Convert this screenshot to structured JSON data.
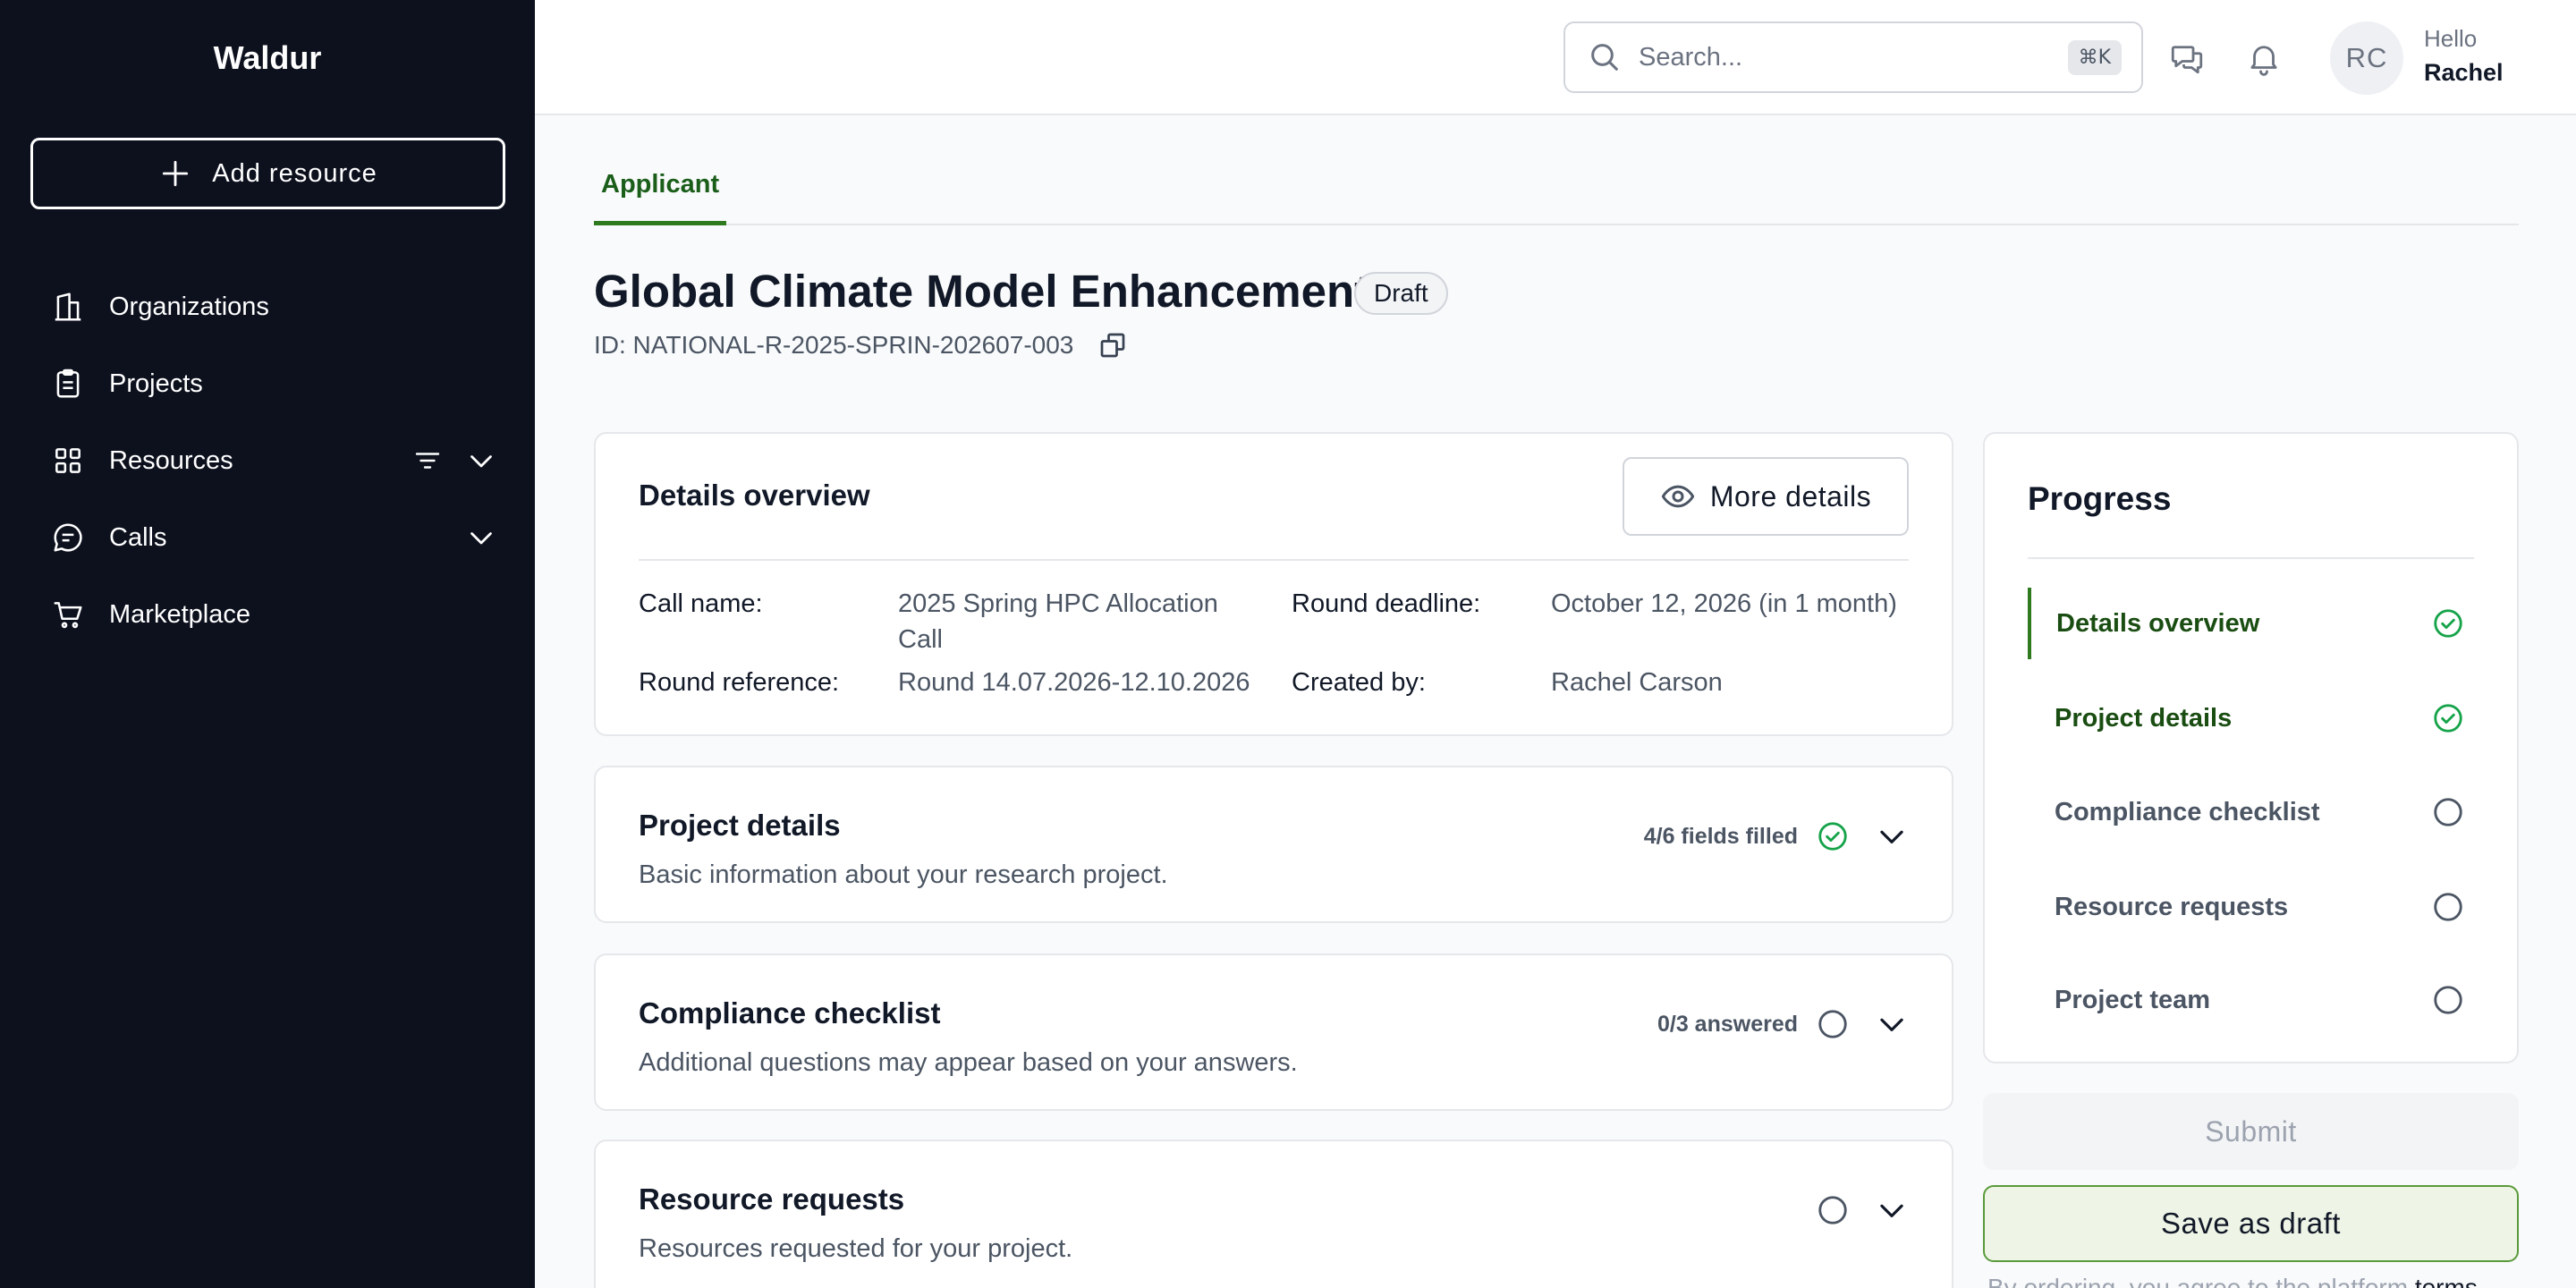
{
  "sidebar": {
    "brand": "Waldur",
    "add_resource_label": "Add resource",
    "items": [
      {
        "label": "Organizations",
        "icon": "building-icon"
      },
      {
        "label": "Projects",
        "icon": "clipboard-icon"
      },
      {
        "label": "Resources",
        "icon": "grid-icon"
      },
      {
        "label": "Calls",
        "icon": "chat-bubble-icon"
      },
      {
        "label": "Marketplace",
        "icon": "cart-icon"
      }
    ]
  },
  "header": {
    "search_placeholder": "Search...",
    "search_shortcut": "⌘K",
    "avatar_initials": "RC",
    "greeting": "Hello",
    "user_name": "Rachel"
  },
  "tabs": [
    {
      "label": "Applicant",
      "active": true
    }
  ],
  "proposal": {
    "title": "Global Climate Model Enhancement",
    "status": "Draft",
    "id_text": "ID: NATIONAL-R-2025-SPRIN-202607-003"
  },
  "details": {
    "title": "Details overview",
    "more_details_label": "More details",
    "call_name_label": "Call name:",
    "call_name_line1": "2025 Spring HPC Allocation",
    "call_name_line2": "Call",
    "round_deadline_label": "Round deadline:",
    "round_deadline": "October 12, 2026 (in 1 month)",
    "round_reference_label": "Round reference:",
    "round_reference": "Round 14.07.2026-12.10.2026",
    "created_by_label": "Created by:",
    "created_by": "Rachel Carson"
  },
  "sections": [
    {
      "title": "Project details",
      "subtitle": "Basic information about your research project.",
      "status": "4/6 fields filled",
      "complete": true
    },
    {
      "title": "Compliance checklist",
      "subtitle": "Additional questions may appear based on your answers.",
      "status": "0/3 answered",
      "complete": false
    },
    {
      "title": "Resource requests",
      "subtitle": "Resources requested for your project.",
      "status": "",
      "complete": false
    }
  ],
  "progress": {
    "title": "Progress",
    "steps": [
      {
        "label": "Details overview",
        "done": true
      },
      {
        "label": "Project details",
        "done": true
      },
      {
        "label": "Compliance checklist",
        "done": false
      },
      {
        "label": "Resource requests",
        "done": false
      },
      {
        "label": "Project team",
        "done": false
      }
    ]
  },
  "actions": {
    "submit_label": "Submit",
    "save_draft_label": "Save as draft",
    "terms_prefix": "By ordering, you agree to the platform ",
    "terms_link": "terms"
  },
  "colors": {
    "sidebar_bg": "#0d111e",
    "accent_green": "#2f7a1f",
    "check_green": "#16a34a"
  }
}
